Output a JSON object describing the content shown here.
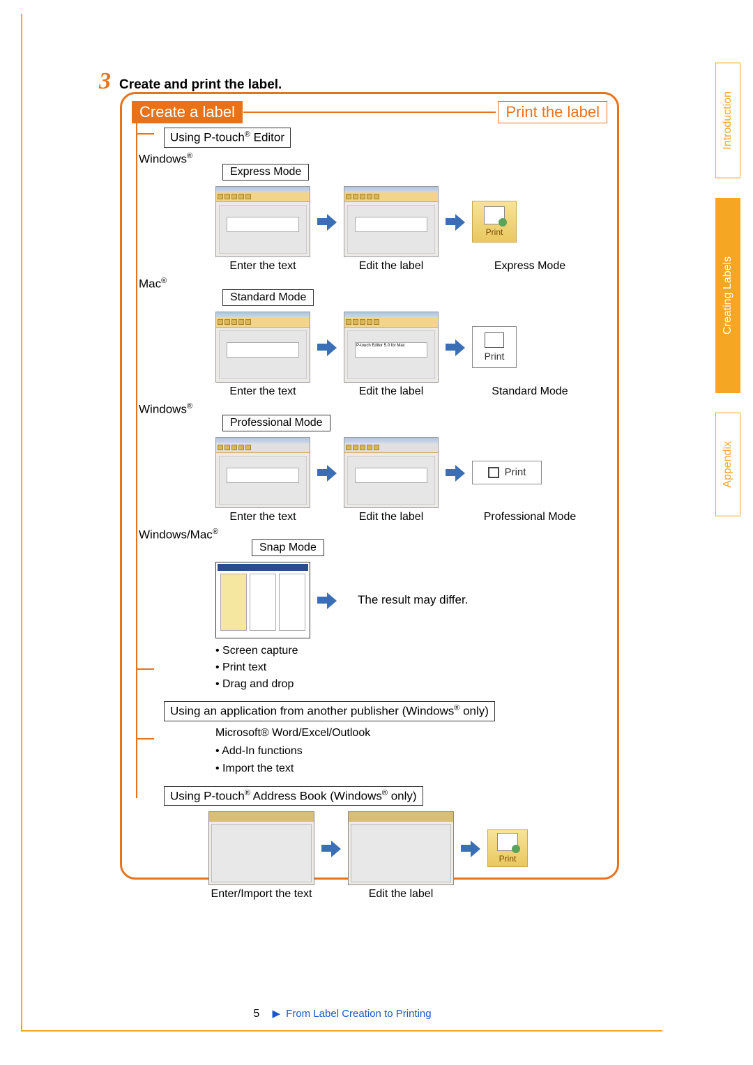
{
  "step": {
    "number": "3",
    "title": "Create and print the label."
  },
  "headers": {
    "left": "Create a label",
    "right": "Print the label"
  },
  "ptouch_box": {
    "prefix": "Using P-touch",
    "suffix": " Editor"
  },
  "os": {
    "windows": "Windows",
    "mac": "Mac",
    "winmac": "Windows/Mac"
  },
  "modes": {
    "express": "Express Mode",
    "standard": "Standard Mode",
    "professional": "Professional Mode",
    "snap": "Snap Mode"
  },
  "captions": {
    "enterText": "Enter the text",
    "editLabel": "Edit the label",
    "enterImport": "Enter/Import the text",
    "result": "The result may differ."
  },
  "print": {
    "label": "Print"
  },
  "snap_bullets": [
    "Screen capture",
    "Print text",
    "Drag and drop"
  ],
  "other_app_box": {
    "prefix": "Using an application from another publisher (Windows",
    "suffix": " only)"
  },
  "other_app": {
    "title": "Microsoft® Word/Excel/Outlook",
    "items": [
      "Add-In functions",
      "Import the text"
    ]
  },
  "addrbook_box": {
    "p1": "Using P-touch",
    "p2": " Address Book (Windows",
    "p3": " only)"
  },
  "side_tabs": {
    "intro": "Introduction",
    "creating": "Creating Labels",
    "appendix": "Appendix"
  },
  "footer": {
    "page": "5",
    "crumb": "From Label Creation to Printing"
  }
}
